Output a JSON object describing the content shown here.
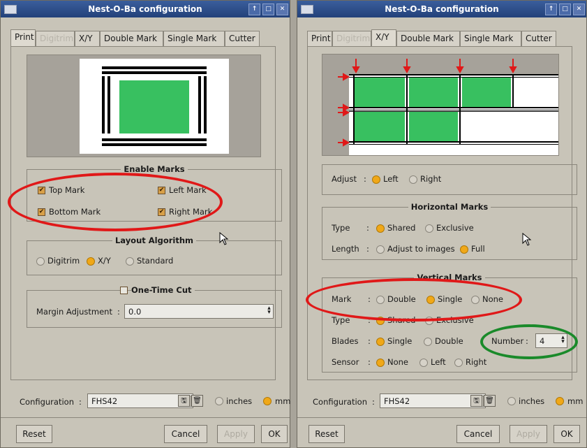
{
  "left": {
    "title": "Nest-O-Ba configuration",
    "tabs": [
      "Print",
      "Digitrim",
      "X/Y",
      "Double Mark",
      "Single Mark",
      "Cutter"
    ],
    "enable_marks": {
      "title": "Enable Marks",
      "top": "Top Mark",
      "left": "Left Mark",
      "bottom": "Bottom Mark",
      "right": "Right Mark"
    },
    "layout": {
      "title": "Layout Algorithm",
      "options": [
        "Digitrim",
        "X/Y",
        "Standard"
      ],
      "selected": "X/Y"
    },
    "onetime": {
      "label": "One-Time Cut",
      "margin_label": "Margin Adjustment",
      "margin_value": "0.0"
    },
    "config": {
      "label": "Configuration",
      "value": "FHS42",
      "inches": "inches",
      "mm": "mm"
    },
    "buttons": {
      "reset": "Reset",
      "cancel": "Cancel",
      "apply": "Apply",
      "ok": "OK"
    }
  },
  "right": {
    "title": "Nest-O-Ba configuration",
    "tabs": [
      "Print",
      "Digitrim",
      "X/Y",
      "Double Mark",
      "Single Mark",
      "Cutter"
    ],
    "adjust": {
      "label": "Adjust",
      "left": "Left",
      "right": "Right",
      "selected": "Left"
    },
    "horizontal": {
      "title": "Horizontal Marks",
      "type_label": "Type",
      "shared": "Shared",
      "exclusive": "Exclusive",
      "length_label": "Length",
      "adjust_images": "Adjust to images",
      "full": "Full"
    },
    "vertical": {
      "title": "Vertical Marks",
      "mark_label": "Mark",
      "double": "Double",
      "single": "Single",
      "none": "None",
      "type_label": "Type",
      "shared": "Shared",
      "exclusive": "Exclusive",
      "blades_label": "Blades",
      "blades_single": "Single",
      "blades_double": "Double",
      "number_label": "Number",
      "number_value": "4",
      "sensor_label": "Sensor",
      "sensor_none": "None",
      "sensor_left": "Left",
      "sensor_right": "Right"
    },
    "config": {
      "label": "Configuration",
      "value": "FHS42",
      "inches": "inches",
      "mm": "mm"
    },
    "buttons": {
      "reset": "Reset",
      "cancel": "Cancel",
      "apply": "Apply",
      "ok": "OK"
    }
  },
  "colors": {
    "accent_radio": "#f0a818",
    "annotation_red": "#e01818",
    "annotation_green": "#1a8a2a",
    "mark_green": "#38c060"
  }
}
